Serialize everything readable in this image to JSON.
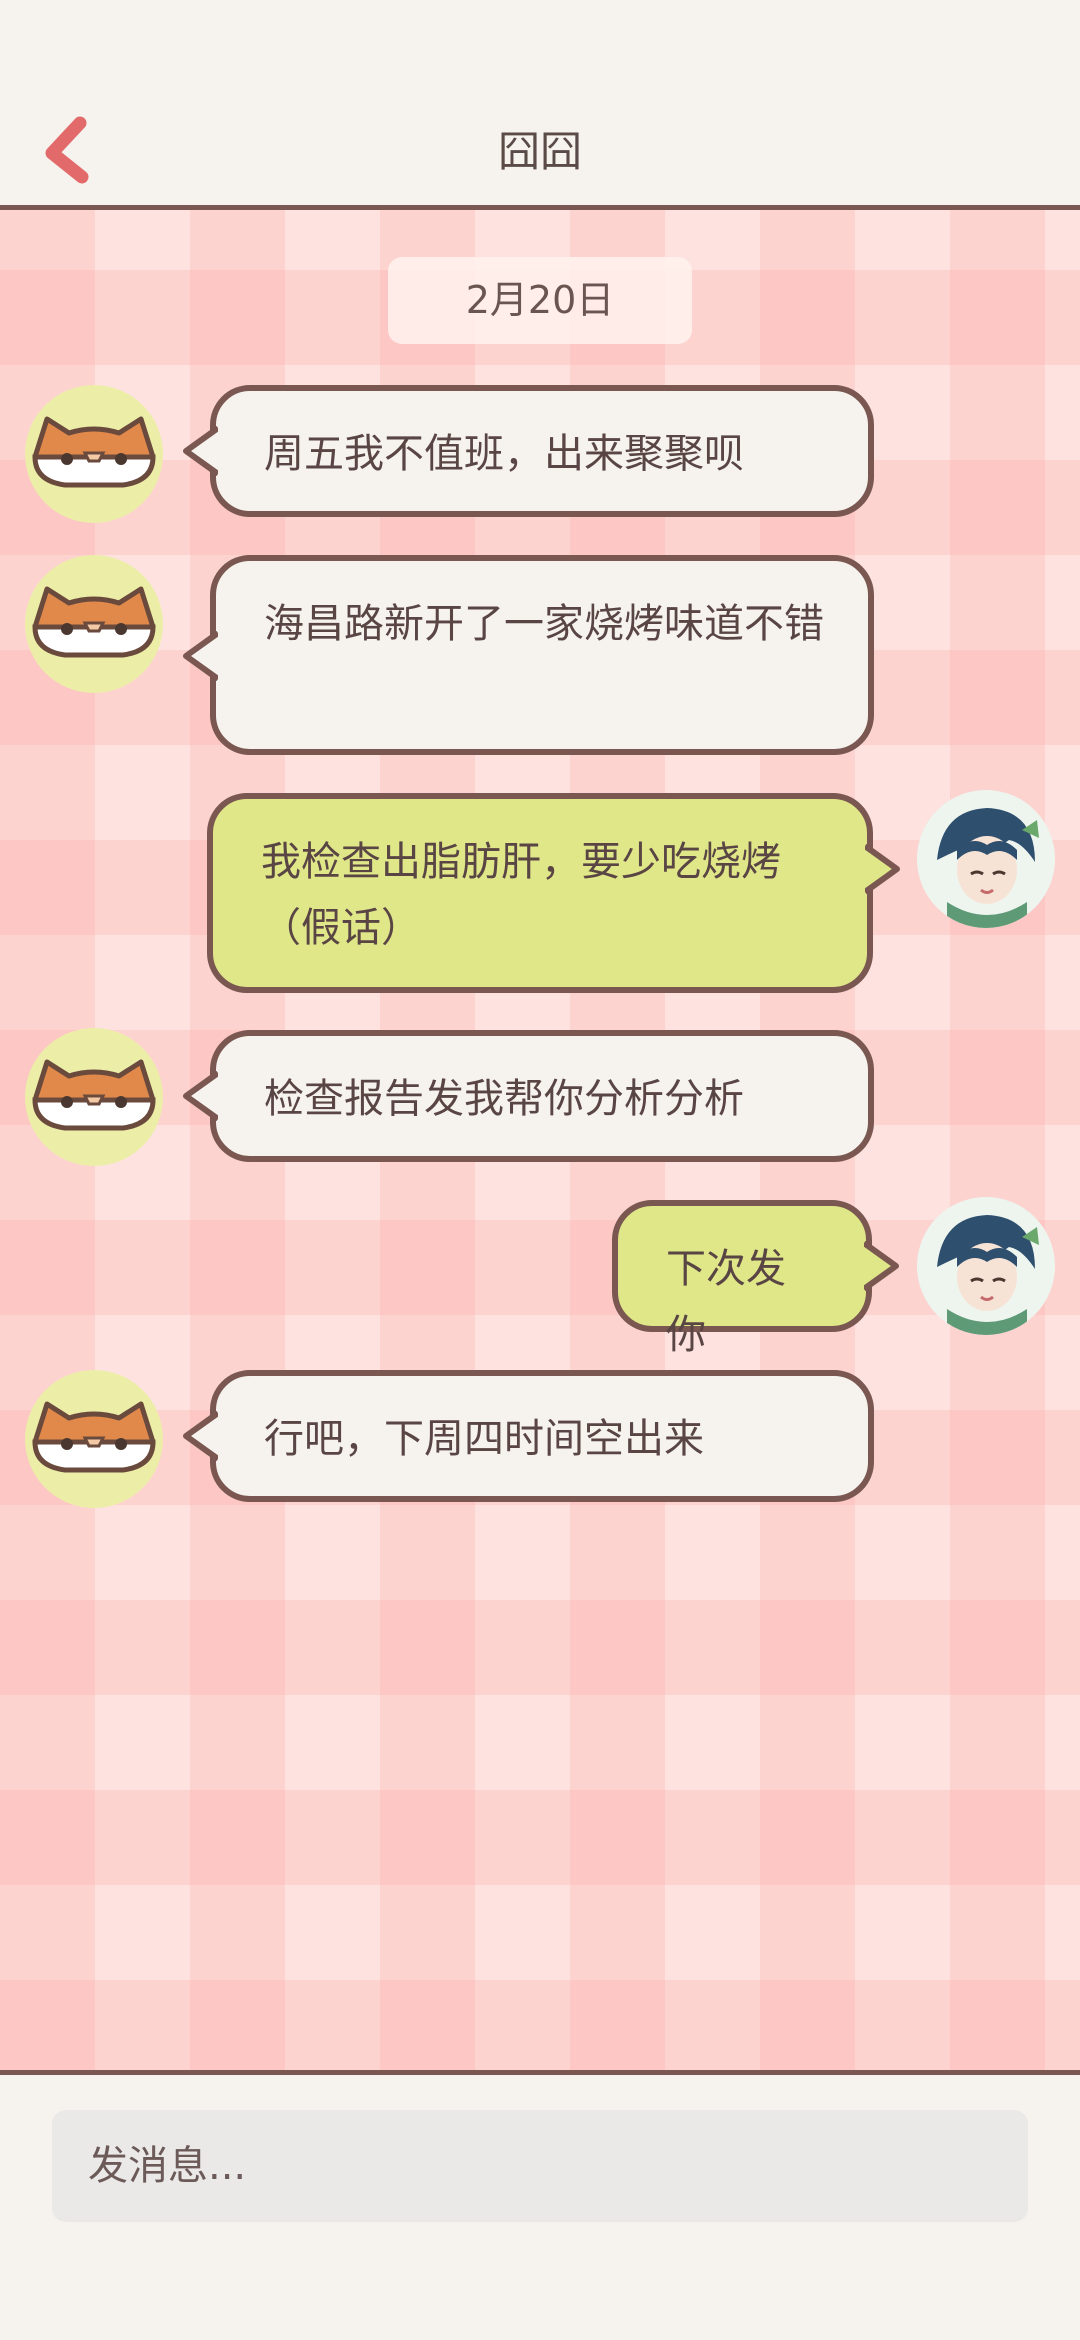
{
  "header": {
    "title": "囧囧",
    "back_icon": "chevron-left-icon",
    "accent": "#e26a6a"
  },
  "chat": {
    "date": "2月20日",
    "messages": [
      {
        "side": "in",
        "text": "周五我不值班，出来聚聚呗"
      },
      {
        "side": "in",
        "text": "海昌路新开了一家烧烤味道不错"
      },
      {
        "side": "out",
        "text": "我检查出脂肪肝，要少吃烧烤（假话）"
      },
      {
        "side": "in",
        "text": "检查报告发我帮你分析分析"
      },
      {
        "side": "out",
        "text": "下次发你"
      },
      {
        "side": "in",
        "text": "行吧，下周四时间空出来"
      }
    ]
  },
  "footer": {
    "placeholder": "发消息..."
  },
  "colors": {
    "bubble_in": "#f6f3ee",
    "bubble_out": "#dfe788",
    "border": "#7a5751",
    "chat_bg": "#fde2df"
  }
}
